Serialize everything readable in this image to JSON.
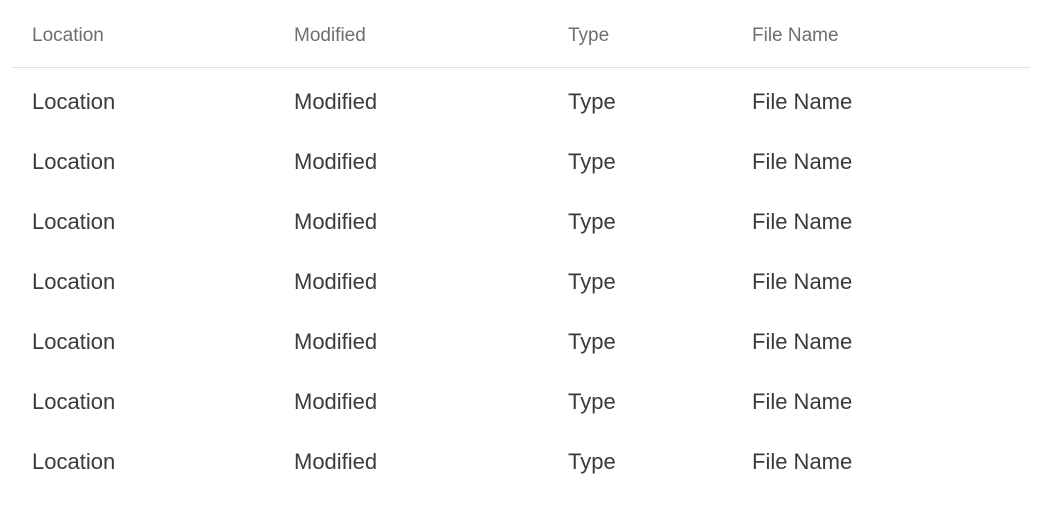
{
  "table": {
    "headers": {
      "location": "Location",
      "modified": "Modified",
      "type": "Type",
      "file_name": "File Name"
    },
    "rows": [
      {
        "location": "Location",
        "modified": "Modified",
        "type": "Type",
        "file_name": "File Name"
      },
      {
        "location": "Location",
        "modified": "Modified",
        "type": "Type",
        "file_name": "File Name"
      },
      {
        "location": "Location",
        "modified": "Modified",
        "type": "Type",
        "file_name": "File Name"
      },
      {
        "location": "Location",
        "modified": "Modified",
        "type": "Type",
        "file_name": "File Name"
      },
      {
        "location": "Location",
        "modified": "Modified",
        "type": "Type",
        "file_name": "File Name"
      },
      {
        "location": "Location",
        "modified": "Modified",
        "type": "Type",
        "file_name": "File Name"
      },
      {
        "location": "Location",
        "modified": "Modified",
        "type": "Type",
        "file_name": "File Name"
      }
    ]
  }
}
